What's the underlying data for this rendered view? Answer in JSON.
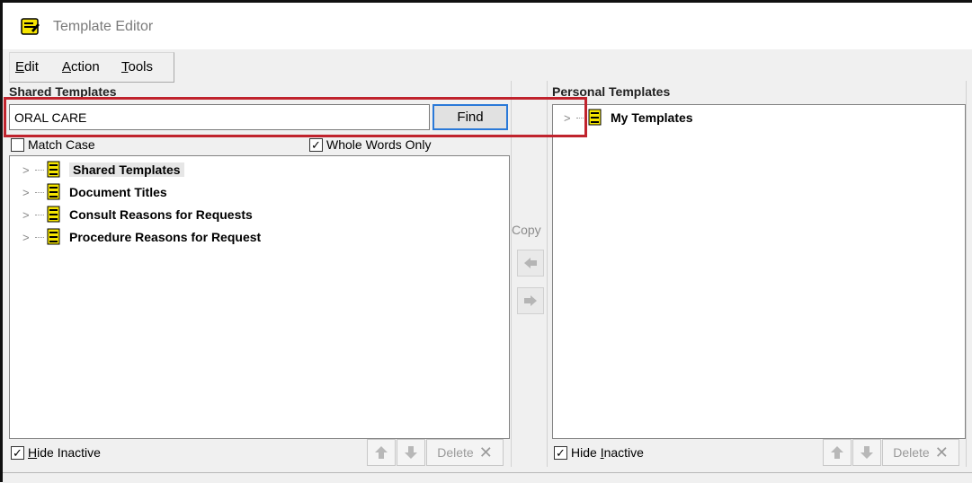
{
  "window": {
    "title": "Template Editor"
  },
  "menu": [
    {
      "underline": "E",
      "rest": "dit"
    },
    {
      "underline": "A",
      "rest": "ction"
    },
    {
      "underline": "T",
      "rest": "ools"
    }
  ],
  "shared": {
    "label_first": "S",
    "label_rest": "hared Templates",
    "search_value": "ORAL CARE",
    "find_label": "Find",
    "match_case_label": "Match Case",
    "match_case_checked": false,
    "whole_words_label": "Whole Words Only",
    "whole_words_checked": true,
    "tree_items": [
      {
        "label": "Shared Templates",
        "selected": true
      },
      {
        "label": "Document Titles",
        "selected": false
      },
      {
        "label": "Consult Reasons for Requests",
        "selected": false
      },
      {
        "label": "Procedure Reasons for Request",
        "selected": false
      }
    ],
    "hide_inactive": {
      "underline": "H",
      "rest": "ide Inactive",
      "checked": true
    },
    "delete_label": "Delete"
  },
  "copy": {
    "label": "Copy"
  },
  "personal": {
    "label_a": "Pers",
    "label_o": "o",
    "label_b": "nal Templates",
    "tree_items": [
      {
        "label": "My Templates"
      }
    ],
    "hide_inactive": {
      "before": "Hide ",
      "underline": "I",
      "rest": "nactive",
      "checked": true
    },
    "delete_label": "Delete"
  },
  "colors": {
    "highlight": "#c0232d",
    "find_border": "#2a79d8",
    "icon_yellow": "#f5e400"
  }
}
